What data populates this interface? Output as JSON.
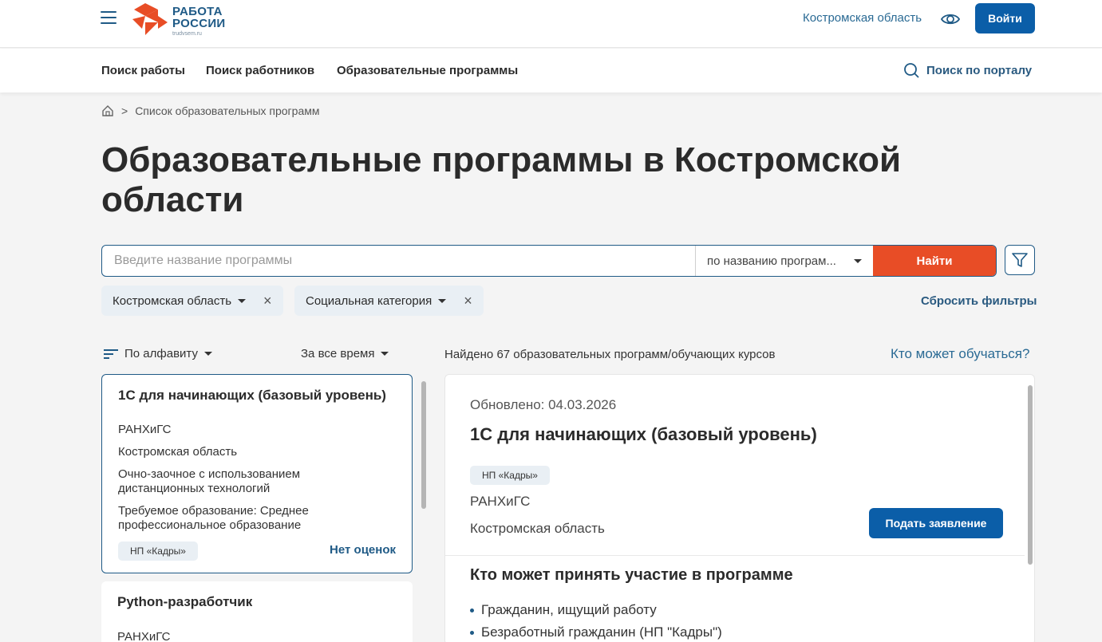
{
  "header": {
    "logo_line1": "РАБОТА",
    "logo_line2": "РОССИИ",
    "logo_sub": "trudvsem.ru",
    "region": "Костромская область",
    "login": "Войти",
    "brand_color": "#e84d26",
    "accent_color": "#0b5ea8"
  },
  "nav": {
    "items": [
      "Поиск работы",
      "Поиск работников",
      "Образовательные программы"
    ],
    "portal_search": "Поиск по порталу"
  },
  "breadcrumb": {
    "separator": ">",
    "current": "Список образовательных программ"
  },
  "page_title": "Образовательные программы в Костромской области",
  "search": {
    "placeholder": "Введите название программы",
    "type": "по названию програм...",
    "button": "Найти"
  },
  "filters": {
    "chips": [
      "Костромская область",
      "Социальная категория"
    ],
    "reset": "Сбросить фильтры"
  },
  "list_controls": {
    "sort": "По алфавиту",
    "period": "За все время",
    "found": "Найдено 67 образовательных программ/обучающих курсов",
    "who_link": "Кто может обучаться?"
  },
  "programs": [
    {
      "title": "1С для начинающих (базовый уровень)",
      "org": "РАНХиГС",
      "region": "Костромская область",
      "format": "Очно-заочное с использованием дистанционных технологий",
      "education": "Требуемое образование: Среднее профессиональное образование",
      "tag": "НП «Кадры»",
      "rating": "Нет оценок"
    },
    {
      "title": "Python-разработчик",
      "org": "РАНХиГС"
    }
  ],
  "detail": {
    "updated": "Обновлено: 04.03.2026",
    "title": "1С для начинающих (базовый уровень)",
    "tag": "НП «Кадры»",
    "org": "РАНХиГС",
    "region": "Костромская область",
    "apply": "Подать заявление",
    "who_title": "Кто может принять участие в программе",
    "who_list": [
      "Гражданин, ищущий работу",
      "Безработный гражданин (НП \"Кадры\")"
    ]
  }
}
